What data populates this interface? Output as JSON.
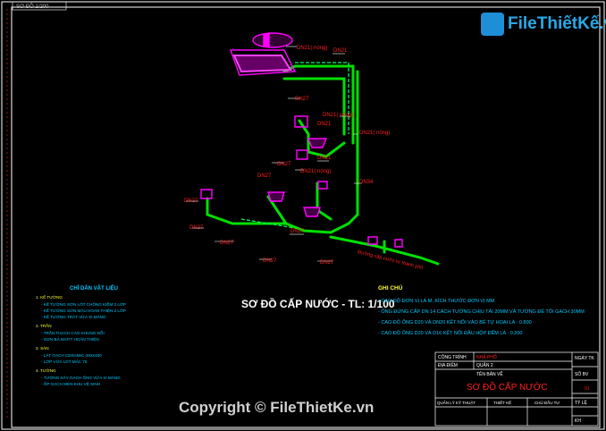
{
  "drawing": {
    "header_tab": "SƠ ĐỒ 1/200",
    "main_title": "SƠ ĐỒ CẤP NƯỚC  -  TL: 1/100",
    "pipe_labels": [
      {
        "id": "p1",
        "text": "DN21( nóng)"
      },
      {
        "id": "p2",
        "text": "DN21"
      },
      {
        "id": "p3",
        "text": "DN27"
      },
      {
        "id": "p4",
        "text": "DN21( nóng)"
      },
      {
        "id": "p5",
        "text": "DN21"
      },
      {
        "id": "p6",
        "text": "DN21( nóng)"
      },
      {
        "id": "p7",
        "text": "DN21"
      },
      {
        "id": "p8",
        "text": "DN27"
      },
      {
        "id": "p9",
        "text": "DN27"
      },
      {
        "id": "p10",
        "text": "DN21( nóng)"
      },
      {
        "id": "p11",
        "text": "DN34"
      },
      {
        "id": "p12",
        "text": "DN27"
      },
      {
        "id": "p13",
        "text": "DN27"
      },
      {
        "id": "p14",
        "text": "DN27"
      },
      {
        "id": "p15",
        "text": "DN27"
      },
      {
        "id": "p16",
        "text": "DN27"
      },
      {
        "id": "p17",
        "text": "DN27"
      },
      {
        "id": "p18",
        "text": "Đường cấp nước từ thành phố"
      }
    ],
    "legend_title": "GHI CHÚ",
    "legend_lines": [
      "- CAO ĐỘ ĐƠN VỊ LÀ M, KÍCH THƯỚC ĐƠN VỊ MM",
      "- ỐNG ĐỨNG CẤP DN 14 CÁCH TƯỜNG CHỊU TẢI 20MM VÀ TƯỜNG ĐỂ TỐI GẠCH 30MM",
      "- CAO ĐỘ ỐNG D20 VÀ DN20 KẾT NỐI VÀO BỂ TỰ HOẠI LÀ : 0.800",
      "- CAO ĐỘ ỐNG D20 VÀ D16 KẾT NỐI ĐẦU HỘP ĐẾM LÀ : 0.200"
    ],
    "spec_title": "CHỈ DẪN VẬT LIỆU",
    "spec_lines": [
      "1. KẾ TƯỜNG",
      "- KẾ TƯỜNG SƠN LÓT CHỐNG KIỀM 2 LỚP",
      "- KẾ TƯỜNG SƠN MÀU HOÀN THIỆN 2 LỚP",
      "- KẾ TƯỜNG TRÁT VỮA XI MĂNG",
      "2. TRẦN",
      "- TRẦN THẠCH CAO KHUNG NỔI",
      "- SƠN BẢ MATIT HOÀN THIỆN",
      "3. SÀN",
      "- LÁT GẠCH CERAMIC 400X400",
      "- LỚP VỮA LÓT MÁC 75",
      "4. TƯỜNG",
      "- TƯỜNG XÂY GẠCH ỐNG VỮA XI MĂNG",
      "- ỐP GẠCH MEN KHU VỆ SINH"
    ]
  },
  "title_block": {
    "project_label": "CÔNG TRÌNH",
    "project_value": "NHÀ PHỐ",
    "location_label": "ĐỊA ĐIỂM",
    "location_value": "QUẬN 2",
    "drawing_name_label": "TÊN BẢN VẼ",
    "drawing_name": "SƠ ĐỒ CẤP NƯỚC",
    "date_label": "NGÀY TK",
    "sheet_label": "SỐ BV",
    "sheet_no": "01",
    "manager_label": "QUẢN LÝ KỸ THUẬT",
    "designer_label": "THIẾT KẾ",
    "chief_label": "CHỦ ĐẦU TƯ",
    "scale_label": "TỶ LỆ",
    "number_label": "KH"
  },
  "watermark": {
    "brand": "FileThiếtKế.vn",
    "copyright": "Copyright © FileThietKe.vn"
  },
  "colors": {
    "pipe_green": "#00e000",
    "frame_white": "#ffffff",
    "label_red": "#ff2020",
    "fixture_magenta": "#ff00ff",
    "text_cyan": "#00c8ff",
    "text_yellow": "#ffff30",
    "brand_blue": "#2aa8e8"
  },
  "icons": {
    "brand": "logo-icon"
  }
}
